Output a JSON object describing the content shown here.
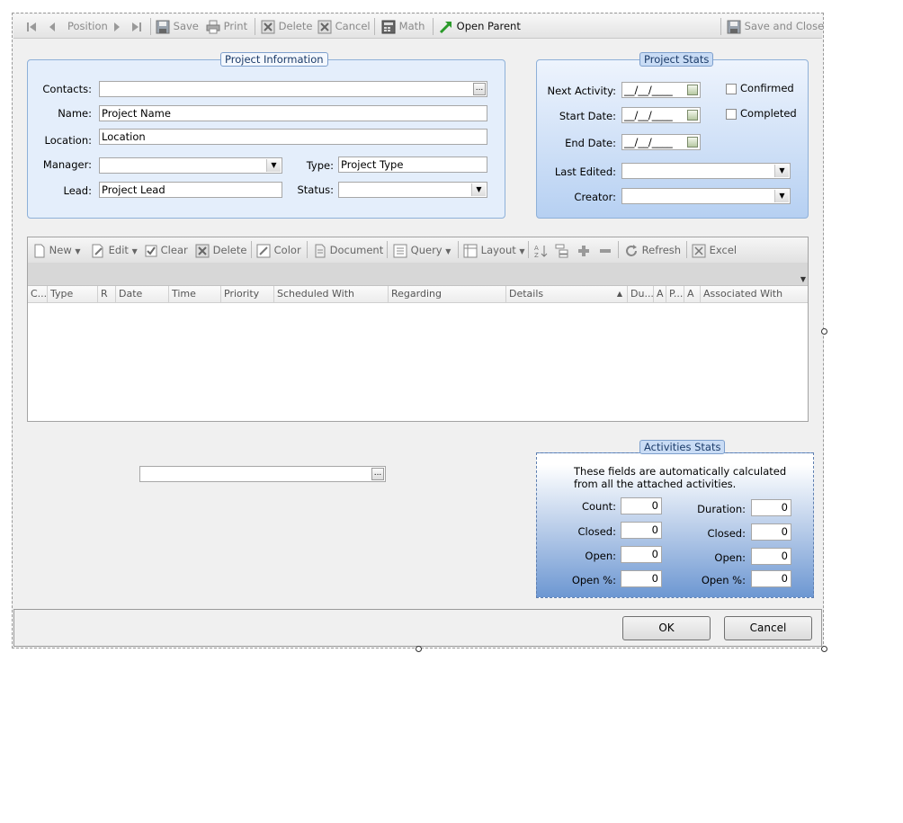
{
  "toolbar": {
    "position": "Position",
    "save": "Save",
    "print": "Print",
    "delete": "Delete",
    "cancel": "Cancel",
    "math": "Math",
    "open_parent": "Open Parent",
    "save_close": "Save and Close"
  },
  "project_info": {
    "legend": "Project Information",
    "contacts_label": "Contacts:",
    "contacts_value": "",
    "name_label": "Name:",
    "name_value": "Project Name",
    "location_label": "Location:",
    "location_value": "Location",
    "manager_label": "Manager:",
    "manager_value": "",
    "type_label": "Type:",
    "type_value": "Project Type",
    "lead_label": "Lead:",
    "lead_value": "Project Lead",
    "status_label": "Status:",
    "status_value": ""
  },
  "project_stats": {
    "legend": "Project Stats",
    "next_activity_label": "Next Activity:",
    "start_date_label": "Start Date:",
    "end_date_label": "End Date:",
    "date_mask": "__/__/____",
    "confirmed_label": "Confirmed",
    "completed_label": "Completed",
    "confirmed": false,
    "completed": false,
    "last_edited_label": "Last Edited:",
    "creator_label": "Creator:"
  },
  "grid_toolbar": {
    "new": "New",
    "edit": "Edit",
    "clear": "Clear",
    "delete": "Delete",
    "color": "Color",
    "document": "Document",
    "query": "Query",
    "layout": "Layout",
    "refresh": "Refresh",
    "excel": "Excel"
  },
  "grid_columns": [
    "C...",
    "Type",
    "R",
    "Date",
    "Time",
    "Priority",
    "Scheduled With",
    "Regarding",
    "Details",
    "Du...",
    "A",
    "P...",
    "A",
    "Associated With"
  ],
  "lookup_value": "",
  "activities_stats": {
    "legend": "Activities Stats",
    "description": "These fields are automatically calculated from all the attached activities.",
    "count_label": "Count:",
    "count": "0",
    "closed_label": "Closed:",
    "closed": "0",
    "open_label": "Open:",
    "open": "0",
    "open_pct_label": "Open %:",
    "open_pct": "0",
    "duration_label": "Duration:",
    "duration": "0",
    "closed2_label": "Closed:",
    "closed2": "0",
    "open2_label": "Open:",
    "open2": "0",
    "open_pct2_label": "Open %:",
    "open_pct2": "0"
  },
  "buttons": {
    "ok": "OK",
    "cancel": "Cancel"
  }
}
